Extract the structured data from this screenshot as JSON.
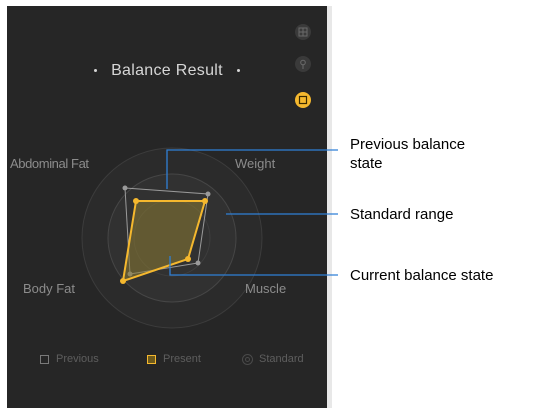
{
  "screen": {
    "title": "Balance Result",
    "axes": {
      "top_left": "Abdominal Fat",
      "top_right": "Weight",
      "bottom_left": "Body Fat",
      "bottom_right": "Muscle"
    },
    "legend": {
      "previous": "Previous",
      "present": "Present",
      "standard": "Standard"
    },
    "side_icons": [
      "grid-icon",
      "pin-icon",
      "frame-icon"
    ],
    "active_icon": "frame-icon"
  },
  "annotations": {
    "previous_line1": "Previous balance",
    "previous_line2": "state",
    "standard": "Standard range",
    "current": "Current balance state"
  },
  "colors": {
    "background": "#262626",
    "accent": "#f5b82e",
    "previous": "#9a9a9a",
    "callout": "#2f7fd6"
  }
}
